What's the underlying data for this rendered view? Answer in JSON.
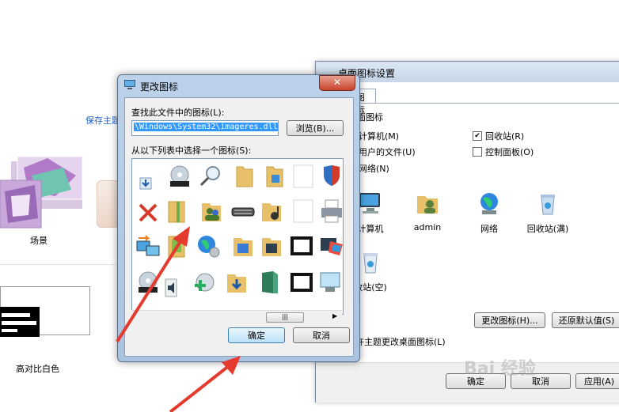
{
  "background_window": {
    "save_theme_link": "保存主题",
    "theme_scene_label": "场景",
    "theme_hc_label": "高对比白色"
  },
  "desktop_icon_settings": {
    "title": "桌面图标设置",
    "tab_label": "图标",
    "group_label": "面图标",
    "checkboxes": [
      {
        "label": "计算机(M)",
        "checked": false
      },
      {
        "label": "回收站(R)",
        "checked": true
      },
      {
        "label": "用户的文件(U)",
        "checked": false
      },
      {
        "label": "控制面板(O)",
        "checked": false
      },
      {
        "label": "网络(N)",
        "checked": false
      }
    ],
    "icons": [
      {
        "label": "计算机",
        "icon": "computer-icon"
      },
      {
        "label": "admin",
        "icon": "user-folder-icon"
      },
      {
        "label": "网络",
        "icon": "network-globe-icon"
      },
      {
        "label": "回收站(满)",
        "icon": "recycle-bin-full-icon"
      },
      {
        "label": "收站(空)",
        "icon": "recycle-bin-empty-icon"
      }
    ],
    "change_icon_button": "更改图标(H)...",
    "restore_default_button": "还原默认值(S)",
    "allow_themes_label": "许主题更改桌面图标(L)",
    "ok_button": "确定",
    "cancel_button": "取消",
    "apply_button": "应用(A)"
  },
  "change_icon_dialog": {
    "title": "更改图标",
    "close_symbol": "✕",
    "find_label": "查找此文件中的图标(L):",
    "path_value": "\\Windows\\System32\\imageres.dll",
    "browse_button": "浏览(B)...",
    "select_label": "从以下列表中选择一个图标(S):",
    "scroll_grip": "|||",
    "scroll_right": "▶",
    "ok_button": "确定",
    "cancel_button": "取消"
  },
  "watermark": "Bai 经验"
}
